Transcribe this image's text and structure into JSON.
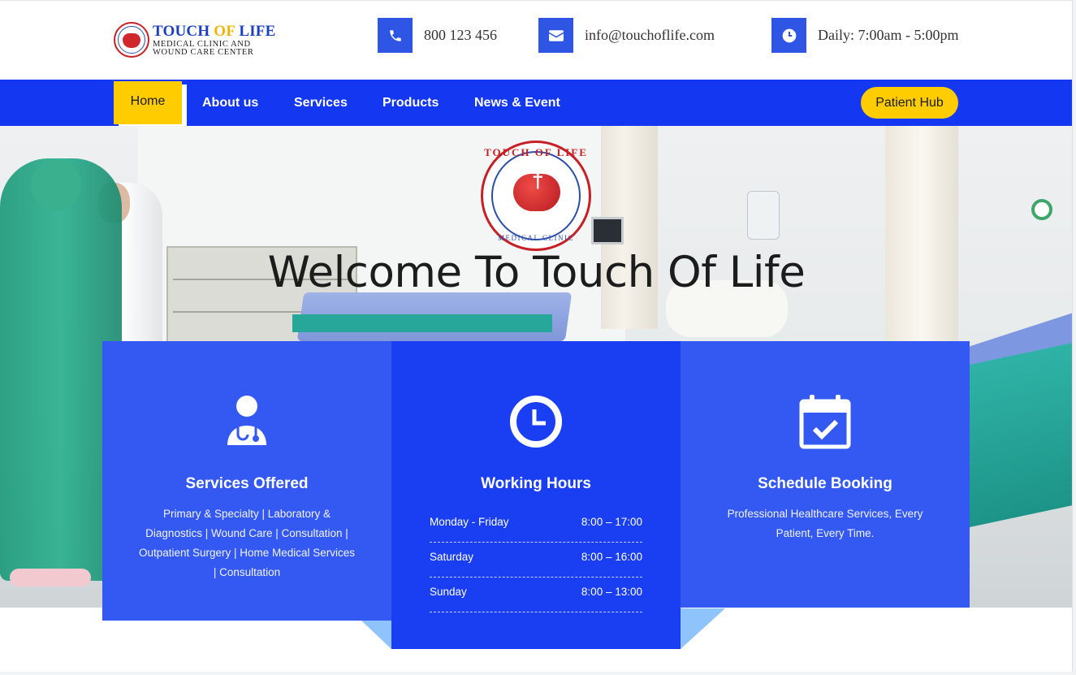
{
  "header": {
    "logo": {
      "title_main": "TOUCH",
      "title_of": "OF",
      "title_end": "LIFE",
      "subtitle_1": "MEDICAL CLINIC AND",
      "subtitle_2": "WOUND CARE CENTER",
      "badge_icon": "clinic-heart-emblem-icon"
    },
    "phone": {
      "icon": "phone-icon",
      "text": "800 123 456"
    },
    "email": {
      "icon": "envelope-icon",
      "text": "info@touchoflife.com"
    },
    "hours": {
      "icon": "clock-icon",
      "text": "Daily: 7:00am - 5:00pm"
    }
  },
  "nav": {
    "items": [
      {
        "label": "Home",
        "active": true
      },
      {
        "label": "About us"
      },
      {
        "label": "Services"
      },
      {
        "label": "Products"
      },
      {
        "label": "News & Event"
      }
    ],
    "cta": "Patient Hub"
  },
  "hero": {
    "emblem": {
      "top_text": "TOUCH OF LIFE",
      "bottom_text": "MEDICAL CLINIC"
    },
    "title": "Welcome To Touch Of Life"
  },
  "cards": {
    "services": {
      "icon": "doctor-stethoscope-icon",
      "title": "Services Offered",
      "description": "Primary & Specialty | Laboratory & Diagnostics | Wound Care | Consultation | Outpatient Surgery | Home Medical Services | Consultation"
    },
    "hours": {
      "icon": "clock-icon",
      "title": "Working Hours",
      "rows": [
        {
          "day": "Monday - Friday",
          "time": "8:00 – 17:00"
        },
        {
          "day": "Saturday",
          "time": "8:00 – 16:00"
        },
        {
          "day": "Sunday",
          "time": "8:00 – 13:00"
        }
      ]
    },
    "booking": {
      "icon": "calendar-check-icon",
      "title": "Schedule Booking",
      "description": "Professional Healthcare Services, Every Patient, Every Time."
    }
  },
  "colors": {
    "primary_blue": "#1437f2",
    "card_blue": "#3459f2",
    "accent_yellow": "#ffcc00",
    "light_blue_accent": "#8ec3fb"
  }
}
